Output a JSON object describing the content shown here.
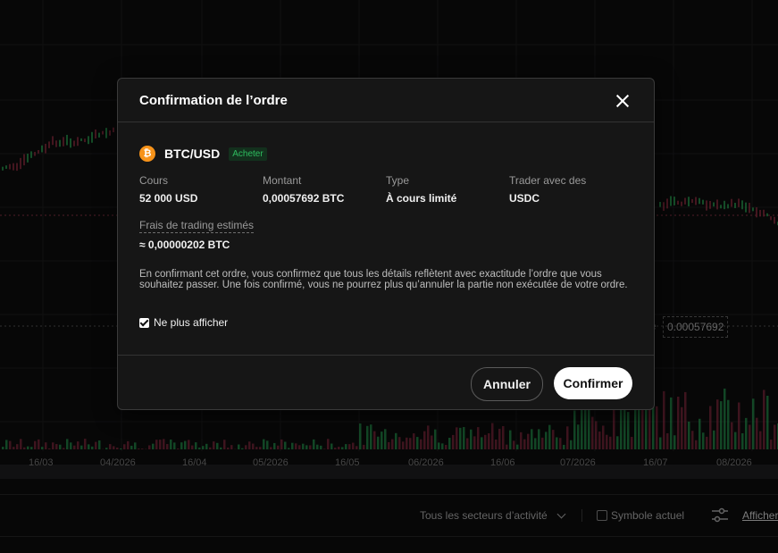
{
  "chart_axis": {
    "x_labels": [
      "16/03",
      "04/2026",
      "16/04",
      "05/2026",
      "16/05",
      "06/2026",
      "16/06",
      "07/2026",
      "16/07",
      "08/2026"
    ],
    "price_tag_prefix": "e",
    "price_tag": "0.00057692"
  },
  "modal": {
    "title": "Confirmation de l’ordre",
    "pair": "BTC/USD",
    "coin_symbol": "₿",
    "side": "Acheter",
    "fields": {
      "price_label": "Cours",
      "price_value": "52 000 USD",
      "amount_label": "Montant",
      "amount_value": "0,00057692 BTC",
      "type_label": "Type",
      "type_value": "À cours limité",
      "trader_label": "Trader avec des",
      "trader_value": "USDC",
      "fees_label": "Frais de trading estimés",
      "fees_value": "≈ 0,00000202 BTC"
    },
    "disclaimer": "En confirmant cet ordre, vous confirmez que tous les détails reflètent avec exactitude l’ordre que vous souhaitez passer. Une fois confirmé, vous ne pourrez plus qu’annuler la partie non exécutée de votre ordre.",
    "dont_show_label": "Ne plus afficher",
    "cancel_label": "Annuler",
    "confirm_label": "Confirmer"
  },
  "bottom_bar": {
    "sector_filter": "Tous les secteurs d’activité",
    "symbol_filter": "Symbole actuel",
    "show_link": "Afficher"
  },
  "colors": {
    "buy_green": "#2ebd5f",
    "sell_red": "#a8324a",
    "btc_orange": "#f7931a"
  }
}
